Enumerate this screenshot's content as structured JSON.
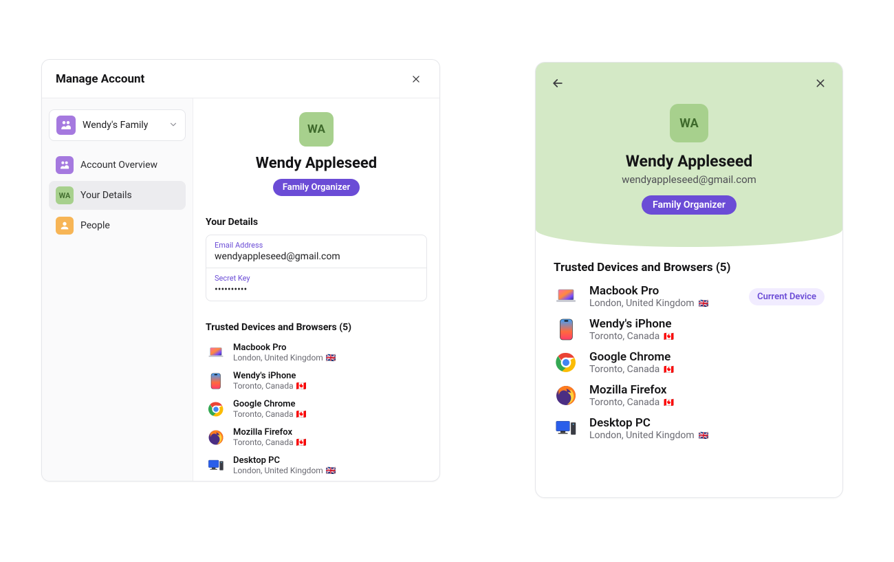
{
  "left_panel": {
    "title": "Manage Account",
    "family_selector": {
      "icon_name": "family-icon",
      "label": "Wendy's Family"
    },
    "nav": [
      {
        "icon": "overview",
        "label": "Account Overview",
        "active": false
      },
      {
        "icon": "initials",
        "initials": "WA",
        "label": "Your Details",
        "active": true
      },
      {
        "icon": "people",
        "label": "People",
        "active": false
      }
    ],
    "profile": {
      "initials": "WA",
      "name": "Wendy Appleseed",
      "role": "Family Organizer"
    },
    "details_section": {
      "title": "Your Details",
      "fields": [
        {
          "label": "Email Address",
          "value": "wendyappleseed@gmail.com"
        },
        {
          "label": "Secret Key",
          "value": "••••••••••"
        }
      ]
    },
    "devices_section": {
      "title": "Trusted Devices and Browsers (5)",
      "devices": [
        {
          "icon": "laptop",
          "name": "Macbook Pro",
          "location": "London, United Kingdom",
          "flag": "🇬🇧"
        },
        {
          "icon": "phone",
          "name": "Wendy's iPhone",
          "location": "Toronto, Canada",
          "flag": "🇨🇦"
        },
        {
          "icon": "chrome",
          "name": "Google Chrome",
          "location": "Toronto, Canada",
          "flag": "🇨🇦"
        },
        {
          "icon": "firefox",
          "name": "Mozilla Firefox",
          "location": "Toronto, Canada",
          "flag": "🇨🇦"
        },
        {
          "icon": "pc",
          "name": "Desktop PC",
          "location": "London, United Kingdom",
          "flag": "🇬🇧"
        }
      ]
    }
  },
  "right_panel": {
    "profile": {
      "initials": "WA",
      "name": "Wendy Appleseed",
      "email": "wendyappleseed@gmail.com",
      "role": "Family Organizer"
    },
    "devices_section": {
      "title": "Trusted Devices and Browsers (5)",
      "current_label": "Current Device",
      "devices": [
        {
          "icon": "laptop",
          "name": "Macbook Pro",
          "location": "London, United Kingdom",
          "flag": "🇬🇧",
          "current": true
        },
        {
          "icon": "phone",
          "name": "Wendy's iPhone",
          "location": "Toronto, Canada",
          "flag": "🇨🇦",
          "current": false
        },
        {
          "icon": "chrome",
          "name": "Google Chrome",
          "location": "Toronto, Canada",
          "flag": "🇨🇦",
          "current": false
        },
        {
          "icon": "firefox",
          "name": "Mozilla Firefox",
          "location": "Toronto, Canada",
          "flag": "🇨🇦",
          "current": false
        },
        {
          "icon": "pc",
          "name": "Desktop PC",
          "location": "London, United Kingdom",
          "flag": "🇬🇧",
          "current": false
        }
      ]
    }
  }
}
